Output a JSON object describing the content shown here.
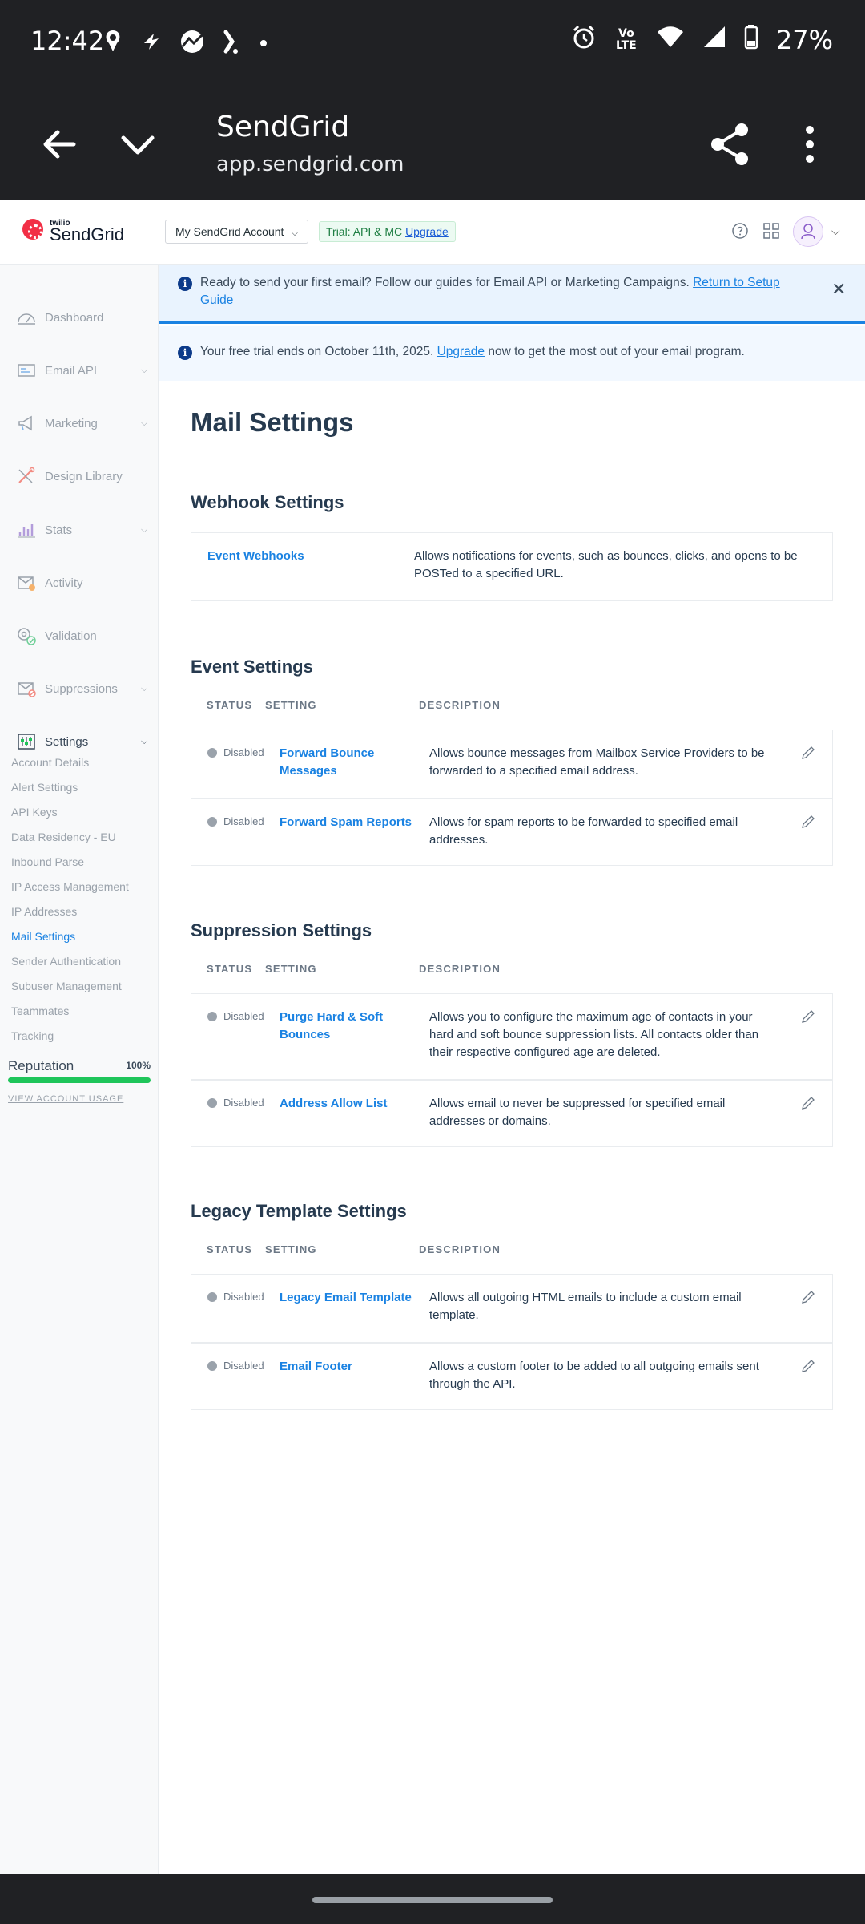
{
  "statusbar": {
    "time": "12:42",
    "battery": "27%",
    "network": "Vo LTE",
    "icons_left": [
      "weather-icon",
      "flash-icon",
      "app-icon",
      "app-k-icon",
      "dot-icon"
    ],
    "icons_right": [
      "alarm-icon",
      "volte-icon",
      "wifi-icon",
      "signal-icon",
      "battery-icon"
    ]
  },
  "browser": {
    "title": "SendGrid",
    "url": "app.sendgrid.com"
  },
  "header": {
    "logo_small": "twilio",
    "logo_text": "SendGrid",
    "account_button": "My SendGrid Account",
    "trial_text": "Trial: API & MC",
    "trial_link": "Upgrade"
  },
  "sidebar": {
    "items": [
      {
        "label": "Dashboard",
        "icon": "gauge-icon"
      },
      {
        "label": "Email API",
        "icon": "email-api-icon"
      },
      {
        "label": "Marketing",
        "icon": "megaphone-icon"
      },
      {
        "label": "Design Library",
        "icon": "design-library-icon"
      },
      {
        "label": "Stats",
        "icon": "stats-icon"
      },
      {
        "label": "Activity",
        "icon": "activity-icon"
      },
      {
        "label": "Validation",
        "icon": "validation-icon"
      },
      {
        "label": "Suppressions",
        "icon": "suppressions-icon"
      },
      {
        "label": "Settings",
        "icon": "settings-icon"
      }
    ],
    "sub_items": [
      "Account Details",
      "Alert Settings",
      "API Keys",
      "Data Residency - EU",
      "Inbound Parse",
      "IP Access Management",
      "IP Addresses",
      "Mail Settings",
      "Sender Authentication",
      "Subuser Management",
      "Teammates",
      "Tracking"
    ],
    "reputation_label": "Reputation",
    "reputation_pct": "100%",
    "reputation_value": 1.0,
    "view_usage": "VIEW ACCOUNT USAGE"
  },
  "banners": {
    "setup_text": "Ready to send your first email? Follow our guides for Email API or Marketing Campaigns.",
    "setup_link": "Return to Setup Guide",
    "trial_pre": "Your free trial ends on October 11th, 2025.",
    "trial_link": "Upgrade",
    "trial_post": "now to get the most out of your email program."
  },
  "main": {
    "title": "Mail Settings",
    "columns": {
      "status": "STATUS",
      "setting": "SETTING",
      "description": "DESCRIPTION"
    },
    "webhook": {
      "heading": "Webhook Settings",
      "setting": "Event Webhooks",
      "description": "Allows notifications for events, such as bounces, clicks, and opens to be POSTed to a specified URL."
    },
    "event": {
      "heading": "Event Settings",
      "rows": [
        {
          "status": "Disabled",
          "setting": "Forward Bounce Messages",
          "description": "Allows bounce messages from Mailbox Service Providers to be forwarded to a specified email address."
        },
        {
          "status": "Disabled",
          "setting": "Forward Spam Reports",
          "description": "Allows for spam reports to be forwarded to specified email addresses."
        }
      ]
    },
    "suppression": {
      "heading": "Suppression Settings",
      "rows": [
        {
          "status": "Disabled",
          "setting": "Purge Hard & Soft Bounces",
          "description": "Allows you to configure the maximum age of contacts in your hard and soft bounce suppression lists. All contacts older than their respective configured age are deleted."
        },
        {
          "status": "Disabled",
          "setting": "Address Allow List",
          "description": "Allows email to never be suppressed for specified email addresses or domains."
        }
      ]
    },
    "legacy": {
      "heading": "Legacy Template Settings",
      "rows": [
        {
          "status": "Disabled",
          "setting": "Legacy Email Template",
          "description": "Allows all outgoing HTML emails to include a custom email template."
        },
        {
          "status": "Disabled",
          "setting": "Email Footer",
          "description": "Allows a custom footer to be added to all outgoing emails sent through the API."
        }
      ]
    }
  }
}
